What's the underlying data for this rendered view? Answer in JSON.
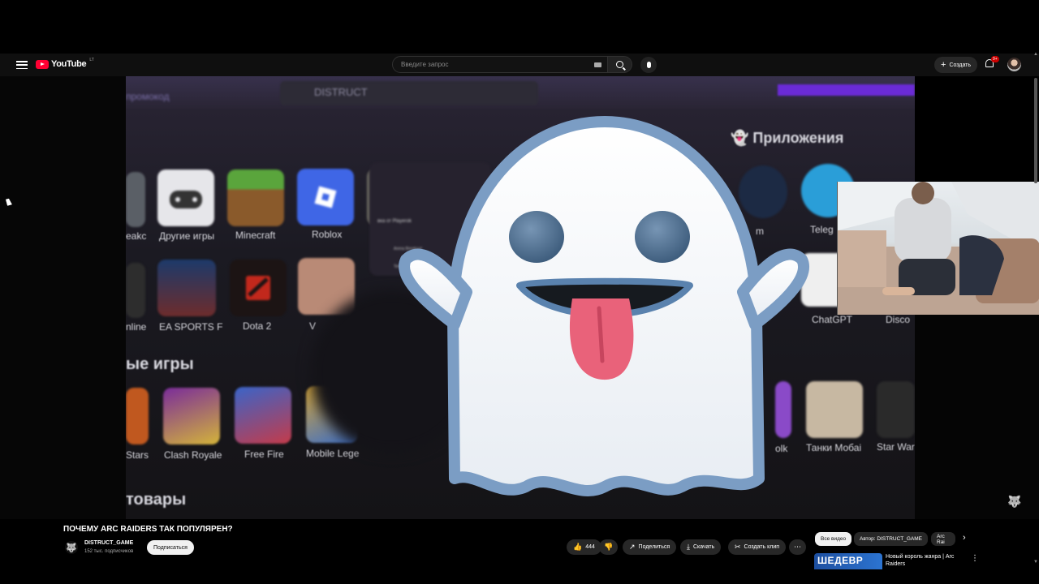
{
  "header": {
    "logo_text": "YouTube",
    "logo_region": "LT",
    "search_placeholder": "Введите запрос",
    "create_label": "Создать",
    "notifications_badge": "9+"
  },
  "video_frame": {
    "promo_text": "промокод",
    "store_name": "DISTRUCT",
    "apps_heading": "Приложения",
    "games_heading": "ые игры",
    "goods_heading": "товары",
    "row1_labels": [
      "eakc",
      "Другие игры",
      "Minecraft",
      "Roblox"
    ],
    "row2_labels": [
      "nline",
      "EA SPORTS F",
      "Dota 2",
      "V"
    ],
    "row3_labels": [
      "Stars",
      "Clash Royale",
      "Free Fire",
      "Mobile Lege"
    ],
    "apps_labels": [
      "m",
      "Teleg",
      "ChatGPT",
      "Disco"
    ],
    "apps_row3_labels": [
      "olk",
      "Танки Мобаі",
      "Star War"
    ],
    "popup_title": "вка от Playerok",
    "popup_item1": "Arena Breakout",
    "popup_item2": "Telegram"
  },
  "video_info": {
    "title": "ПОЧЕМУ ARC RAIDERS ТАК ПОПУЛЯРЕН?",
    "channel_name": "DISTRUCT_GAME",
    "subscribers": "152 тыс. подписчиков",
    "subscribe_label": "Подписаться",
    "likes": "444",
    "share_label": "Поделиться",
    "download_label": "Скачать",
    "clip_label": "Создать клип"
  },
  "sidebar_recs": {
    "chips": [
      "Все видео",
      "Автор: DISTRUCT_GAME",
      "Arc Rai"
    ],
    "rec_thumb_text": "ШЕДЕВР",
    "rec_title": "Новый король жанра | Arc Raiders"
  },
  "colors": {
    "brand_red": "#ff0033",
    "background": "#0f0f0f",
    "accent_purple": "#6a2bd6"
  }
}
